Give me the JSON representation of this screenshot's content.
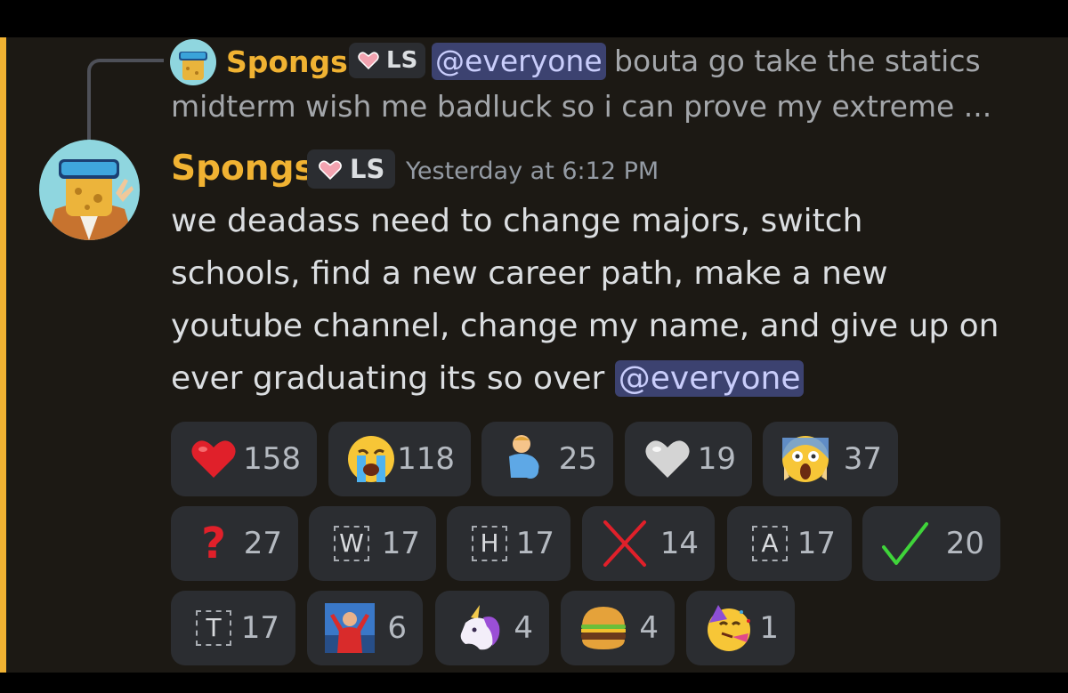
{
  "reply": {
    "author": "Spongs",
    "tag": "LS",
    "mention": "@everyone",
    "text_line1": "bouta go take the statics",
    "text_line2": "midterm wish me badluck so i can prove my extreme ..."
  },
  "message": {
    "author": "Spongs",
    "tag": "LS",
    "timestamp": "Yesterday at 6:12 PM",
    "lines": [
      "we deadass need to change majors, switch",
      "schools, find a new career path, make a new",
      "youtube channel, change my name, and give up on"
    ],
    "last_line_text": "ever graduating its so over ",
    "last_line_mention": "@everyone"
  },
  "colors": {
    "accent": "#f0b232",
    "mention_bg": "#3c4270",
    "mention_fg": "#c9cdfb",
    "reaction_bg": "#2b2d31"
  },
  "reactions": [
    {
      "icon": "red-heart-icon",
      "count": "158"
    },
    {
      "icon": "loudly-crying-face-icon",
      "count": "118"
    },
    {
      "icon": "pregnant-man-icon",
      "count": "25"
    },
    {
      "icon": "white-heart-icon",
      "count": "19"
    },
    {
      "icon": "face-screaming-icon",
      "count": "37"
    },
    {
      "icon": "question-mark-icon",
      "count": "27"
    },
    {
      "icon": "letter-w-icon",
      "letter": "W",
      "count": "17"
    },
    {
      "icon": "letter-h-icon",
      "letter": "H",
      "count": "17"
    },
    {
      "icon": "cross-mark-icon",
      "count": "14"
    },
    {
      "icon": "letter-a-icon",
      "letter": "A",
      "count": "17"
    },
    {
      "icon": "check-mark-icon",
      "count": "20"
    },
    {
      "icon": "letter-t-icon",
      "letter": "T",
      "count": "17"
    },
    {
      "icon": "celebrating-man-icon",
      "count": "6"
    },
    {
      "icon": "unicorn-icon",
      "count": "4"
    },
    {
      "icon": "hamburger-icon",
      "count": "4"
    },
    {
      "icon": "partying-face-icon",
      "count": "1"
    }
  ]
}
